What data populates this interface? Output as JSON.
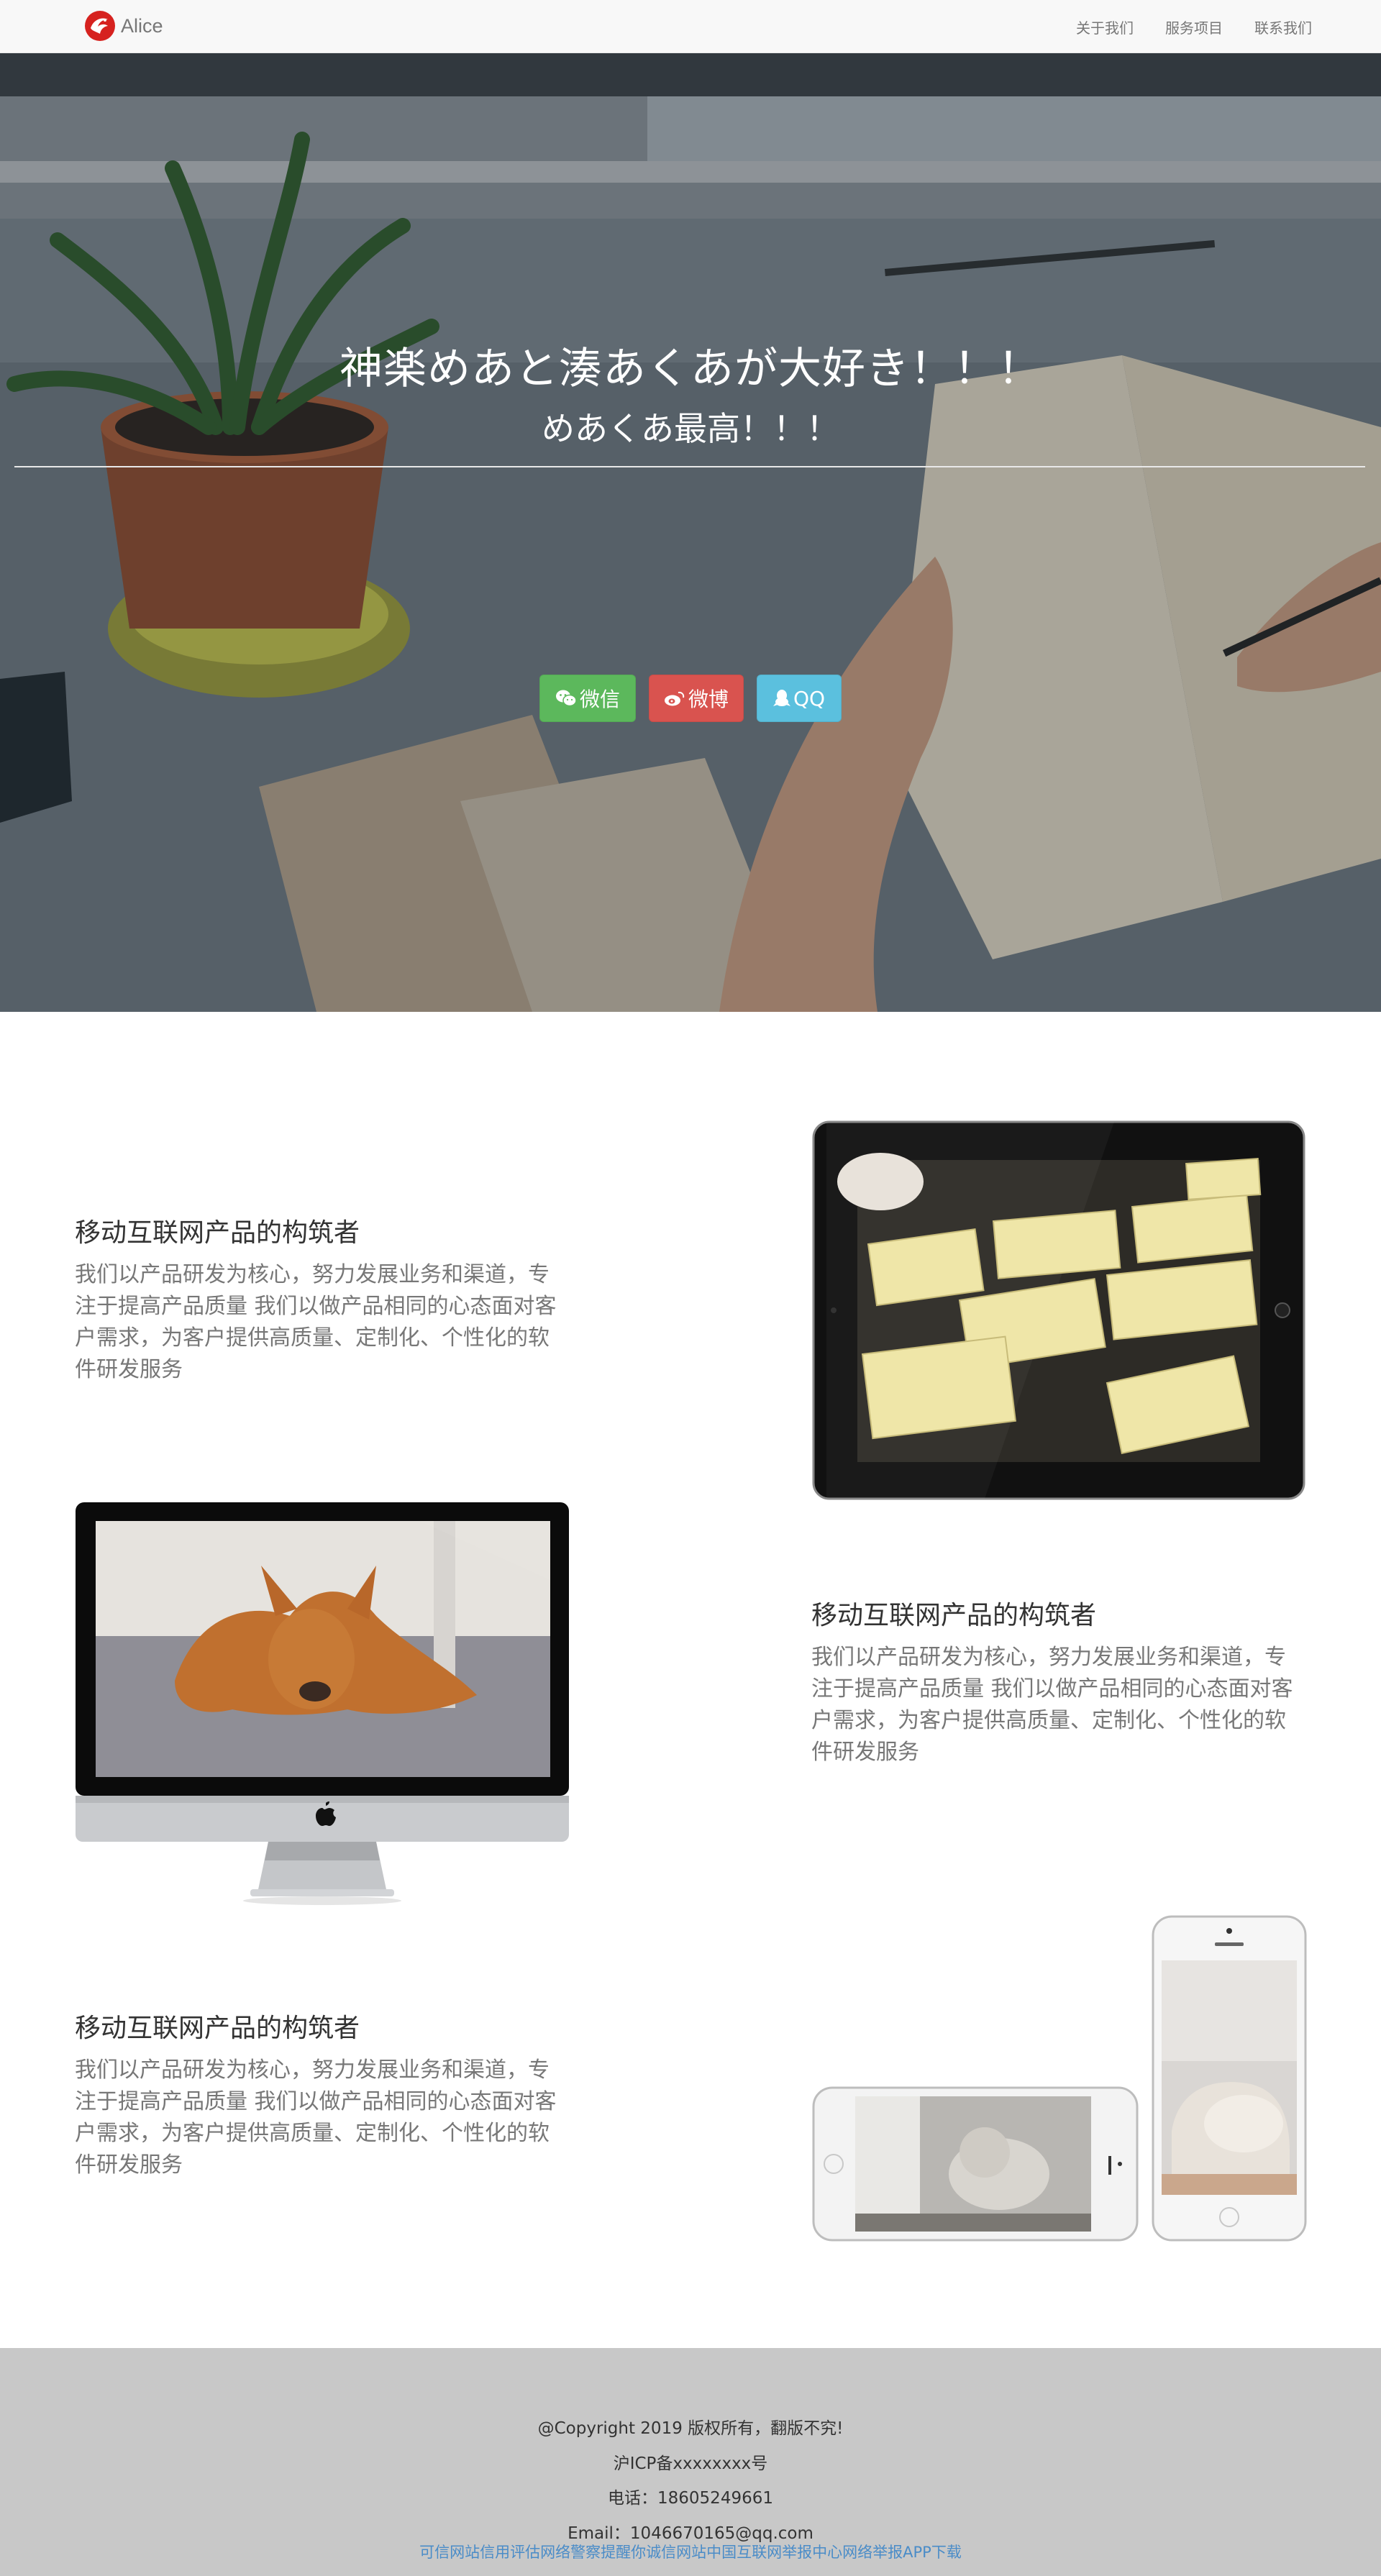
{
  "navbar": {
    "brand": "Alice",
    "links": [
      "关于我们",
      "服务项目",
      "联系我们"
    ]
  },
  "hero": {
    "title": "神楽めあと湊あくあが大好き！！！",
    "subtitle": "めあくあ最高！！！",
    "buttons": {
      "wechat": "微信",
      "weibo": "微博",
      "qq": "QQ"
    }
  },
  "features": [
    {
      "title": "移动互联网产品的构筑者",
      "description": "我们以产品研发为核心，努力发展业务和渠道，专注于提高产品质量 我们以做产品相同的心态面对客户需求，为客户提供高质量、定制化、个性化的软件研发服务"
    },
    {
      "title": "移动互联网产品的构筑者",
      "description": "我们以产品研发为核心，努力发展业务和渠道，专注于提高产品质量 我们以做产品相同的心态面对客户需求，为客户提供高质量、定制化、个性化的软件研发服务"
    },
    {
      "title": "移动互联网产品的构筑者",
      "description": "我们以产品研发为核心，努力发展业务和渠道，专注于提高产品质量 我们以做产品相同的心态面对客户需求，为客户提供高质量、定制化、个性化的软件研发服务"
    }
  ],
  "footer": {
    "copyright": "@Copyright 2019 版权所有，翻版不究!",
    "icp": "沪ICP备xxxxxxxx号",
    "phone": "电话：18605249661",
    "email": "Email：1046670165@qq.com",
    "links": "可信网站信用评估网络警察提醒你诚信网站中国互联网举报中心网络举报APP下载"
  },
  "colors": {
    "wechat": "#5cb85c",
    "weibo": "#d9534f",
    "qq": "#5bc0de",
    "footer_bg": "#c8c8c8",
    "link": "#4a8cc8"
  }
}
